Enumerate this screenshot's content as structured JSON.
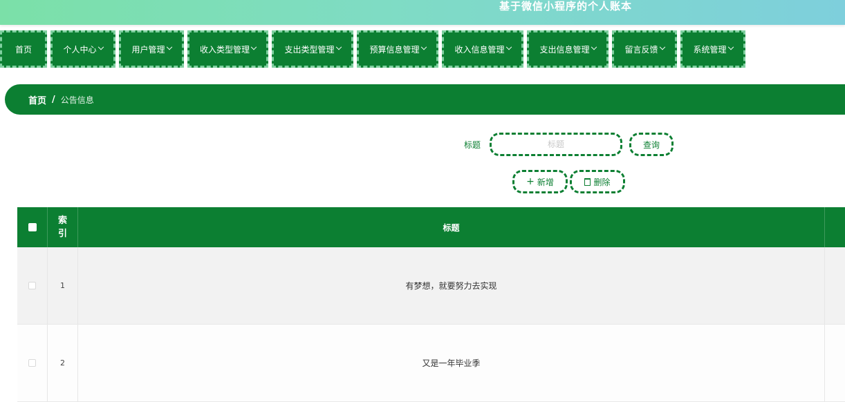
{
  "app": {
    "title": "基于微信小程序的个人账本"
  },
  "nav": {
    "items": [
      {
        "label": "首页",
        "has_dropdown": false
      },
      {
        "label": "个人中心",
        "has_dropdown": true
      },
      {
        "label": "用户管理",
        "has_dropdown": true
      },
      {
        "label": "收入类型管理",
        "has_dropdown": true
      },
      {
        "label": "支出类型管理",
        "has_dropdown": true
      },
      {
        "label": "预算信息管理",
        "has_dropdown": true
      },
      {
        "label": "收入信息管理",
        "has_dropdown": true
      },
      {
        "label": "支出信息管理",
        "has_dropdown": true
      },
      {
        "label": "留言反馈",
        "has_dropdown": true
      },
      {
        "label": "系统管理",
        "has_dropdown": true
      }
    ]
  },
  "breadcrumb": {
    "home": "首页",
    "separator": "/",
    "current": "公告信息"
  },
  "search": {
    "label": "标题",
    "placeholder": "标题",
    "query_label": "查询"
  },
  "actions": {
    "add_label": "新增",
    "delete_label": "删除"
  },
  "table": {
    "columns": {
      "index": [
        "索",
        "引"
      ],
      "title": "标题"
    },
    "rows": [
      {
        "index": "1",
        "title": "有梦想，就要努力去实现"
      },
      {
        "index": "2",
        "title": "又是一年毕业季"
      }
    ]
  },
  "colors": {
    "primary": "#0c7f32",
    "header_gradient_start": "#7be0a8",
    "header_gradient_end": "#7ecfdc",
    "dashed_border": "#7fd0a0"
  }
}
